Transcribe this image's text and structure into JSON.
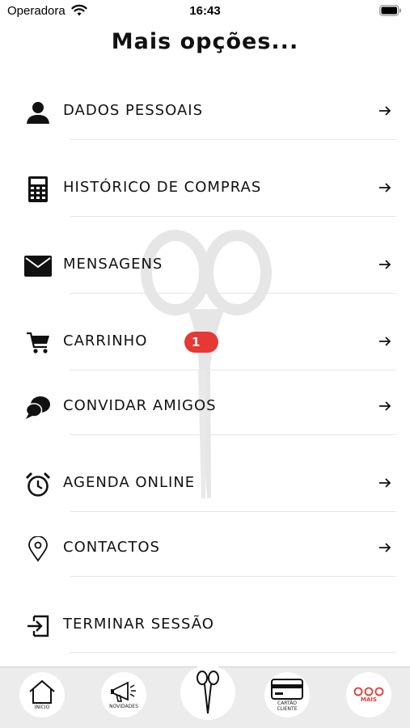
{
  "status_bar": {
    "carrier": "Operadora",
    "time": "16:43",
    "icons": [
      "wifi-icon",
      "battery-icon"
    ]
  },
  "page": {
    "title": "Mais opções..."
  },
  "menu": [
    {
      "label": "DADOS PESSOAIS",
      "icon": "person-icon"
    },
    {
      "label": "HISTÓRICO DE COMPRAS",
      "icon": "calculator-icon"
    },
    {
      "label": "MENSAGENS",
      "icon": "envelope-icon"
    },
    {
      "label": "CARRINHO",
      "icon": "cart-icon",
      "badge": "1"
    },
    {
      "label": "CONVIDAR AMIGOS",
      "icon": "chat-bubbles-icon"
    },
    {
      "label": "AGENDA ONLINE",
      "icon": "alarm-clock-icon"
    },
    {
      "label": "CONTACTOS",
      "icon": "location-pin-icon"
    },
    {
      "label": "TERMINAR SESSÃO",
      "icon": "logout-icon"
    }
  ],
  "tab_bar": {
    "items": [
      {
        "label": "INÍCIO",
        "icon": "home-icon"
      },
      {
        "label": "NOVIDADES",
        "icon": "megaphone-icon"
      },
      {
        "label": "",
        "icon": "scissors-icon"
      },
      {
        "label": "CARTÃO CLIENTE",
        "icon": "card-icon"
      },
      {
        "label": "MAIS",
        "icon": "more-dots-icon",
        "active": true
      }
    ]
  },
  "colors": {
    "accent": "#e53935",
    "text": "#111111",
    "tab_bar_bg": "#ececec",
    "watermark": "#e8e8e8"
  }
}
